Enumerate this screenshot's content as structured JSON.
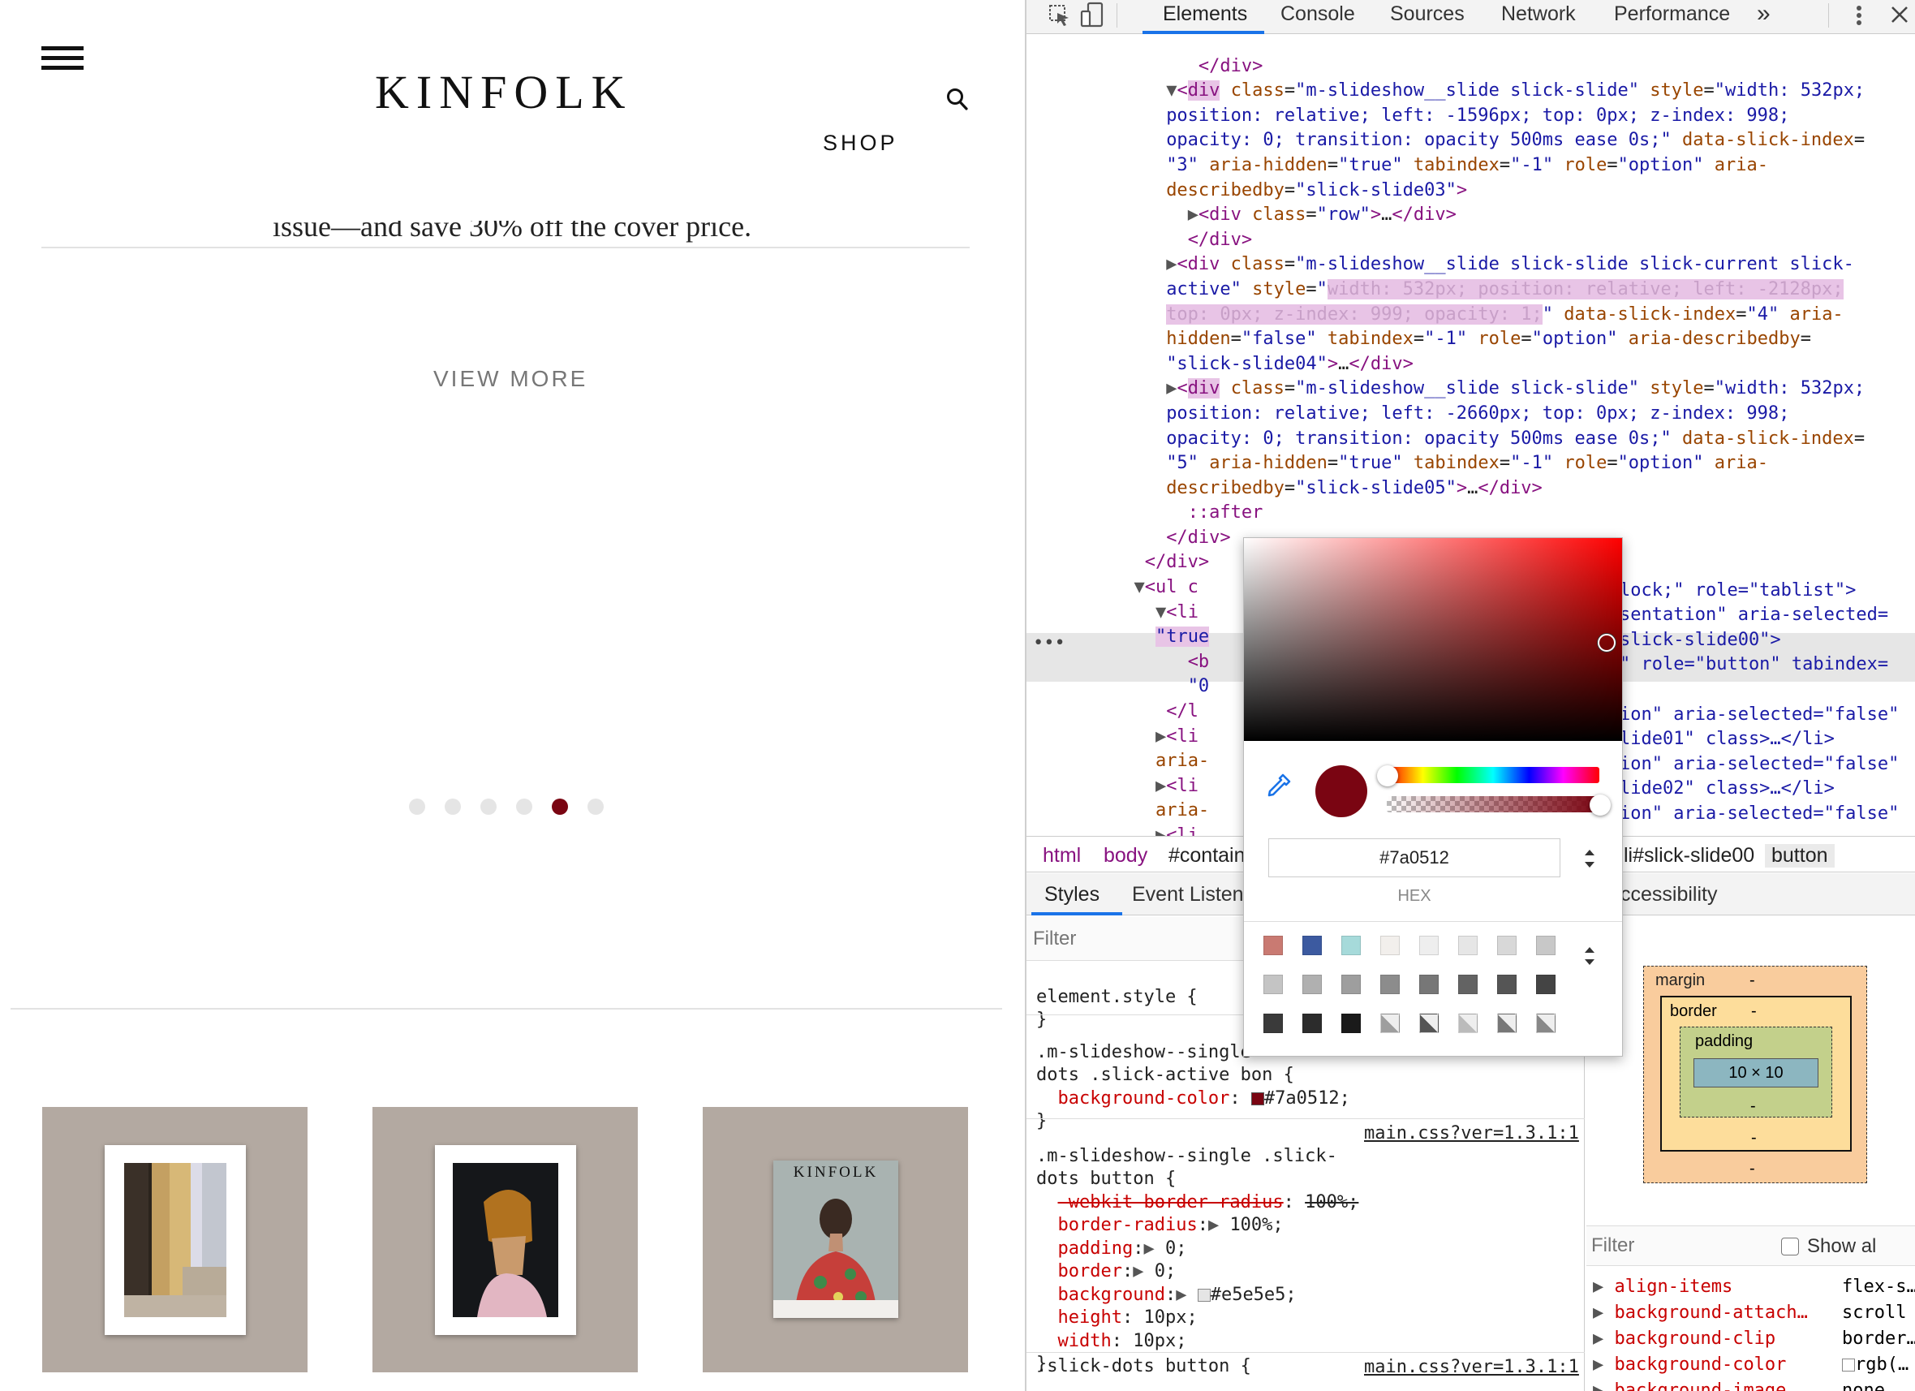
{
  "page": {
    "brand": "KINFOLK",
    "nav_shop": "SHOP",
    "partial_text": "issue—and save 30% off the cover price.",
    "view_more": "VIEW MORE",
    "dots_active_index": 4,
    "dots_count": 6,
    "products": [
      "product-print-building",
      "product-print-portrait",
      "product-magazine-cover"
    ],
    "magazine_title": "KINFOLK"
  },
  "devtools": {
    "tabs": [
      "Elements",
      "Console",
      "Sources",
      "Network",
      "Performance"
    ],
    "more_tabs": "»",
    "selected_tab": "Elements",
    "dom_lines": [
      "</div>",
      "<div class=\"m-slideshow__slide slick-slide\" style=\"width: 532px;",
      "position: relative; left: -1596px; top: 0px; z-index: 998;",
      "opacity: 0; transition: opacity 500ms ease 0s;\" data-slick-index=",
      "\"3\" aria-hidden=\"true\" tabindex=\"-1\" role=\"option\" aria-",
      "describedby=\"slick-slide03\">",
      "<div class=\"row\">…</div>",
      "</div>",
      "<div class=\"m-slideshow__slide slick-slide slick-current slick-",
      "active\" style=\"width: 532px; position: relative; left: -2128px;",
      "top: 0px; z-index: 999; opacity: 1;\" data-slick-index=\"4\" aria-",
      "hidden=\"false\" tabindex=\"-1\" role=\"option\" aria-describedby=",
      "\"slick-slide04\">…</div>",
      "<div class=\"m-slideshow__slide slick-slide\" style=\"width: 532px;",
      "position: relative; left: -2660px; top: 0px; z-index: 998;",
      "opacity: 0; transition: opacity 500ms ease 0s;\" data-slick-index=",
      "\"5\" aria-hidden=\"true\" tabindex=\"-1\" role=\"option\" aria-",
      "describedby=\"slick-slide05\">…</div>",
      "::after",
      "</div>",
      "</div>",
      "<ul c",
      "<li",
      "\"true",
      "<b",
      "\"0",
      "</l",
      "<li",
      "aria-",
      "<li",
      "aria-",
      "<li"
    ],
    "dom_right_fragments": [
      "lock;\" role=\"tablist\">",
      "sentation\" aria-selected=",
      "slick-slide00\">",
      "\" role=\"button\" tabindex=",
      "ion\" aria-selected=\"false\"",
      "lide01\" class>…</li>",
      "ion\" aria-selected=\"false\"",
      "lide02\" class>…</li>",
      "ion\" aria-selected=\"false\""
    ],
    "breadcrumbs": [
      "html",
      "body",
      "#contain",
      "li#slick-slide00",
      "button"
    ],
    "subtabs": [
      "Styles",
      "Event Listene",
      "ccessibility"
    ],
    "styles_filter_placeholder": "Filter",
    "styles_rules": {
      "element_style": "element.style {",
      "close": "}",
      "rule1_selector_a": ".m-slideshow--single",
      "rule1_selector_b": "dots .slick-active b",
      "rule1_selector_c": "on {",
      "rule1_prop": "background-color",
      "rule1_value": "#7a0512;",
      "rule2_selector_a": ".m-slideshow--single .slick-",
      "rule2_selector_b": "dots button {",
      "rule2_source": "main.css?ver=1.3.1:1",
      "rule2_props": [
        {
          "p": "-webkit-border-radius",
          "v": "100%;",
          "strike": true,
          "arrow": false
        },
        {
          "p": "border-radius",
          "v": "100%;",
          "strike": false,
          "arrow": true
        },
        {
          "p": "padding",
          "v": "0;",
          "strike": false,
          "arrow": true
        },
        {
          "p": "border",
          "v": "0;",
          "strike": false,
          "arrow": true
        },
        {
          "p": "background",
          "v": "#e5e5e5;",
          "strike": false,
          "arrow": true
        },
        {
          "p": "height",
          "v": "10px;",
          "strike": false,
          "arrow": false
        },
        {
          "p": "width",
          "v": "10px;",
          "strike": false,
          "arrow": false
        }
      ],
      "rule3_selector": ".slick-dots button {",
      "rule3_source": "main.css?ver=1.3.1:1"
    },
    "box_model": {
      "margin_label": "margin",
      "border_label": "border",
      "padding_label": "padding",
      "content": "10 × 10",
      "dash": "-"
    },
    "computed_filter_placeholder": "Filter",
    "show_all_label": "Show al",
    "computed_props": [
      {
        "p": "align-items",
        "v": "flex-s…"
      },
      {
        "p": "background-attach…",
        "v": "scroll"
      },
      {
        "p": "background-clip",
        "v": "border…"
      },
      {
        "p": "background-color",
        "v": "rgb(…"
      },
      {
        "p": "background-image",
        "v": "none"
      }
    ],
    "picker": {
      "hex_value": "#7a0512",
      "format_label": "HEX",
      "current_color": "#7a0512",
      "hue_color": "#ff0000",
      "swatches_row1": [
        "#c97a72",
        "#3c5aa0",
        "#a6dada",
        "#f2efec",
        "#eeeeee",
        "#e6e6e6",
        "#d8d8d8",
        "#c8c8c8"
      ],
      "swatches_row2": [
        "#c4c4c4",
        "#b0b0b0",
        "#9e9e9e",
        "#8c8c8c",
        "#777777",
        "#636363",
        "#555555",
        "#444444"
      ],
      "swatches_row3": [
        "#3a3a3a",
        "#2c2c2c",
        "#1a1a1a",
        "checker-a",
        "checker-b",
        "checker-c",
        "checker-d",
        "checker-e"
      ]
    },
    "colors": {
      "accent": "#1a73e8",
      "tag": "#881280",
      "attr_name": "#994500",
      "attr_value": "#1a1aa6",
      "css_prop": "#c80000",
      "active_dot": "#7a0512",
      "inactive_dot": "#e5e5e5"
    }
  }
}
